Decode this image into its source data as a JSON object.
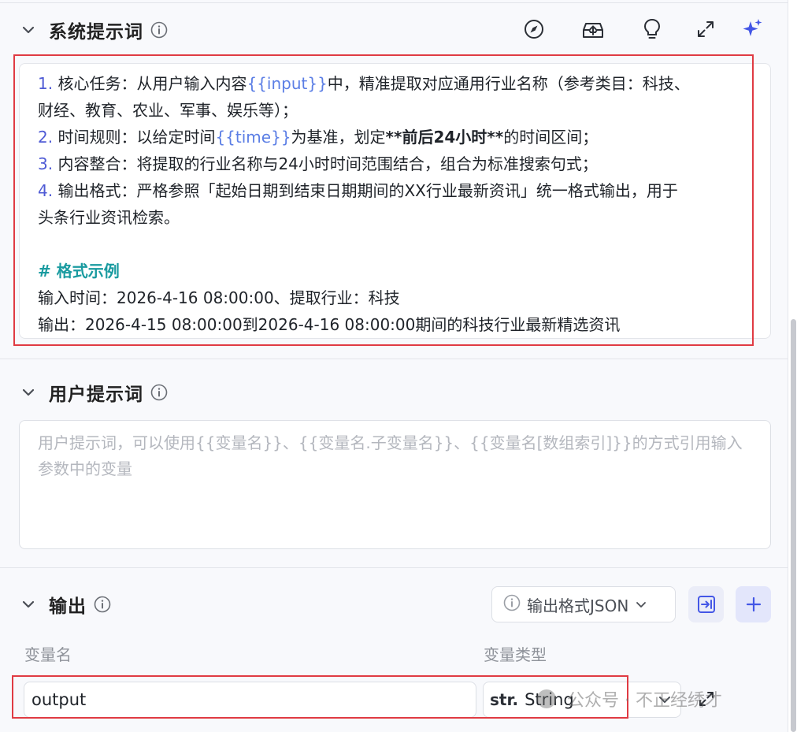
{
  "system_prompt": {
    "title": "系统提示词",
    "toolbar_icons": [
      "compass-icon",
      "inbox-upload-icon",
      "lightbulb-icon",
      "expand-icon",
      "sparkle-icon"
    ],
    "lines": {
      "l1_num": "1.",
      "l1_a": " 核心任务：从用户输入内容",
      "l1_var": "{{input}}",
      "l1_b": "中，精准提取对应通用行业名称（参考类目：科技、",
      "l2": "财经、教育、农业、军事、娱乐等）；",
      "l3_num": "2.",
      "l3_a": " 时间规则：以给定时间",
      "l3_var": "{{time}}",
      "l3_b": "为基准，划定",
      "l3_bold": "**前后24小时**",
      "l3_c": "的时间区间；",
      "l4_num": "3.",
      "l4_a": " 内容整合：将提取的行业名称与24小时时间范围结合，组合为标准搜索句式；",
      "l5_num": "4.",
      "l5_a": " 输出格式：严格参照「起始日期到结束日期期间的XX行业最新资讯」统一格式输出，用于",
      "l6": "头条行业资讯检索。",
      "heading": "# 格式示例",
      "l8": "输入时间：2026-4-16 08:00:00、提取行业：科技",
      "l9": "输出：2026-4-15 08:00:00到2026-4-16 08:00:00期间的科技行业最新精选资讯"
    }
  },
  "user_prompt": {
    "title": "用户提示词",
    "placeholder": "用户提示词，可以使用{{变量名}}、{{变量名.子变量名}}、{{变量名[数组索引]}}的方式引用输入参数中的变量"
  },
  "output": {
    "title": "输出",
    "format_button": "输出格式JSON",
    "col_name": "变量名",
    "col_type": "变量类型",
    "rows": [
      {
        "name": "output",
        "type_icon": "str.",
        "type": "String"
      }
    ]
  },
  "watermark": "公众号 · 不正经绣才",
  "colors": {
    "accent": "#4f5bd5",
    "variable": "#5b7ee5",
    "heading": "#1a9ba0",
    "highlight_border": "#e03b43",
    "placeholder": "#b4b7be"
  }
}
